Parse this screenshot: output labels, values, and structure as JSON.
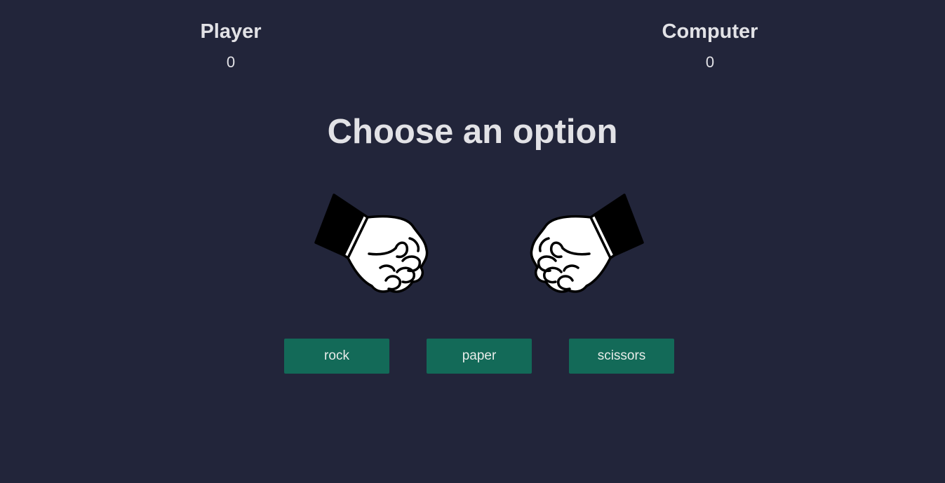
{
  "scoreboard": {
    "player": {
      "name": "Player",
      "score": "0"
    },
    "computer": {
      "name": "Computer",
      "score": "0"
    }
  },
  "title": "Choose an option",
  "hands": {
    "player": "rock-fist-icon",
    "computer": "rock-fist-icon"
  },
  "options": {
    "rock": "rock",
    "paper": "paper",
    "scissors": "scissors"
  },
  "colors": {
    "background": "#22253a",
    "button": "#136a58",
    "text": "#e2e2e6"
  }
}
